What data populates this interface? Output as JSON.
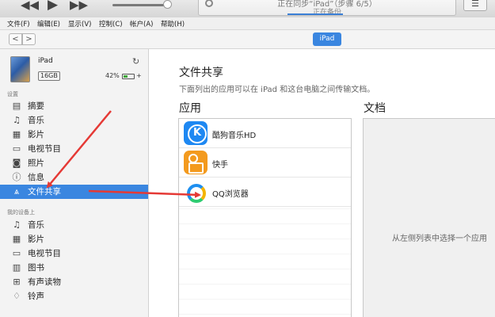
{
  "player": {
    "prev_glyph": "◀◀",
    "play_glyph": "▶",
    "next_glyph": "▶▶",
    "volume_level": 0.9,
    "status_title": "正在同步“iPad”（步骤 6/5）",
    "status_sub": "正在备份",
    "list_glyph": "☰"
  },
  "menu": {
    "items": [
      "文件(F)",
      "编辑(E)",
      "显示(V)",
      "控制(C)",
      "帐户(A)",
      "帮助(H)"
    ]
  },
  "nav": {
    "back_glyph": "<",
    "forward_glyph": ">",
    "device_button": "iPad"
  },
  "device": {
    "name": "iPad",
    "capacity": "16GB",
    "battery_text": "42%",
    "battery_level": 0.42,
    "charging_glyph": "+",
    "sync_glyph": "↻"
  },
  "sidebar": {
    "settings_label": "设置",
    "settings_items": [
      {
        "label": "摘要",
        "icon": "summary-icon",
        "glyph": "▤"
      },
      {
        "label": "音乐",
        "icon": "music-icon",
        "glyph": "♫"
      },
      {
        "label": "影片",
        "icon": "film-icon",
        "glyph": "▦"
      },
      {
        "label": "电视节目",
        "icon": "tv-icon",
        "glyph": "▭"
      },
      {
        "label": "照片",
        "icon": "camera-icon",
        "glyph": "◙"
      },
      {
        "label": "信息",
        "icon": "info-icon",
        "glyph": "ⓘ"
      },
      {
        "label": "文件共享",
        "icon": "app-store-icon",
        "glyph": "⩓",
        "selected": true
      }
    ],
    "mydevice_label": "我的设备上",
    "device_items": [
      {
        "label": "音乐",
        "icon": "music-icon",
        "glyph": "♫"
      },
      {
        "label": "影片",
        "icon": "film-icon",
        "glyph": "▦"
      },
      {
        "label": "电视节目",
        "icon": "tv-icon",
        "glyph": "▭"
      },
      {
        "label": "图书",
        "icon": "book-icon",
        "glyph": "▥"
      },
      {
        "label": "有声读物",
        "icon": "audiobook-icon",
        "glyph": "⊞"
      },
      {
        "label": "铃声",
        "icon": "bell-icon",
        "glyph": "♢"
      }
    ]
  },
  "main": {
    "title": "文件共享",
    "description": "下面列出的应用可以在 iPad 和这台电脑之间传输文档。",
    "apps_heading": "应用",
    "docs_heading": "文档",
    "apps": [
      {
        "name": "酷狗音乐HD",
        "icon": "kugou-icon"
      },
      {
        "name": "快手",
        "icon": "kuaishou-icon"
      },
      {
        "name": "QQ浏览器",
        "icon": "qq-browser-icon"
      }
    ],
    "docs_hint": "从左侧列表中选择一个应用"
  },
  "colors": {
    "accent": "#3a86e0",
    "annotation_arrow": "#e53935"
  }
}
